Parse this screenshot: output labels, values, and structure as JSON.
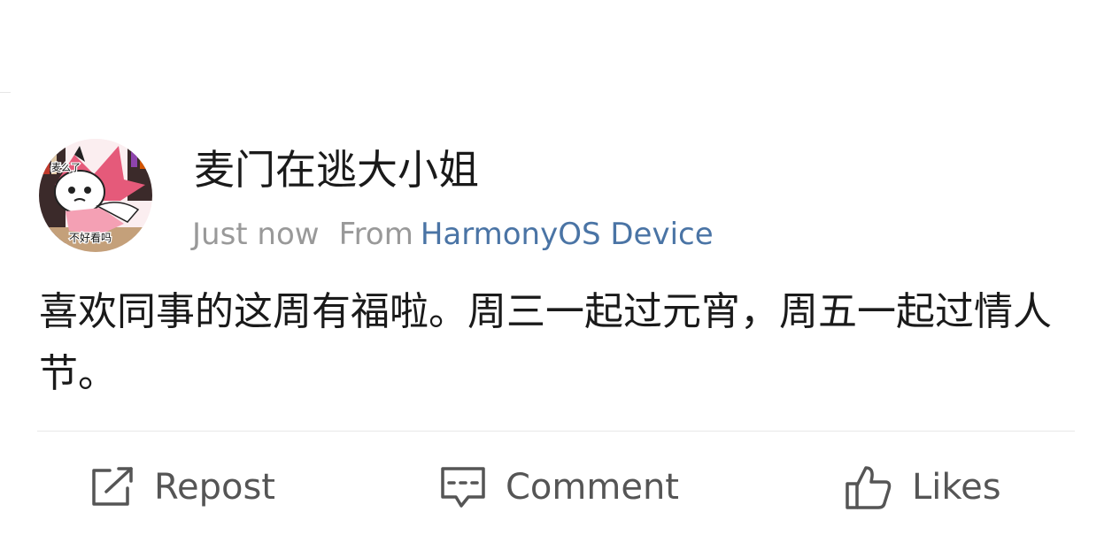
{
  "post": {
    "username": "麦门在逃大小姐",
    "time": "Just now",
    "from_label": "From",
    "device": "HarmonyOS Device",
    "text": "喜欢同事的这周有福啦。周三一起过元宵，周五一起过情人节。"
  },
  "avatar": {
    "sticker_text_top": "麦么了",
    "sticker_text_bottom": "不好看吗"
  },
  "actions": {
    "repost": "Repost",
    "comment": "Comment",
    "likes": "Likes"
  },
  "colors": {
    "link": "#4a74a5",
    "meta": "#999999",
    "text": "#1a1a1a",
    "action": "#555555"
  }
}
